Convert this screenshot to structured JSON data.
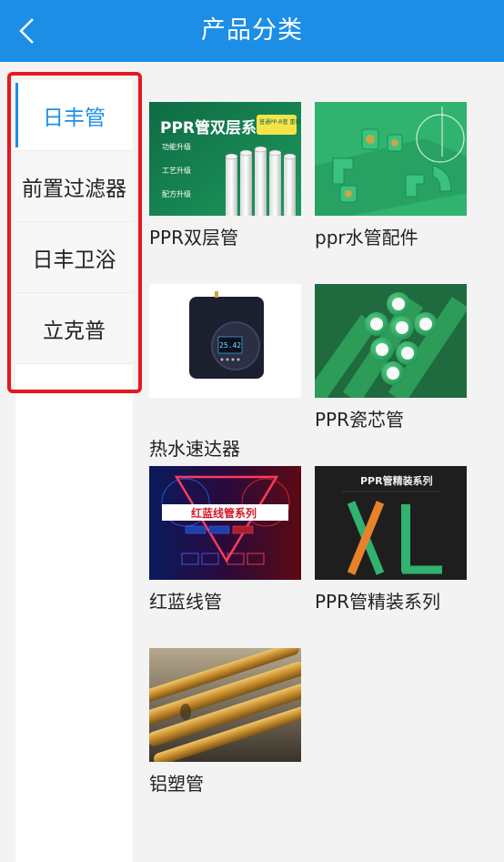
{
  "header": {
    "title": "产品分类"
  },
  "sidebar": {
    "items": [
      {
        "label": "日丰管",
        "active": true
      },
      {
        "label": "前置过滤器",
        "active": false
      },
      {
        "label": "日丰卫浴",
        "active": false
      },
      {
        "label": "立克普",
        "active": false
      }
    ]
  },
  "products": [
    {
      "name": "PPR双层管",
      "image": {
        "title_text": "PPR管双层系列",
        "lines": [
          "功能升级",
          "工艺升级",
          "配方升级"
        ],
        "badge": "普通PP-R管 重磅升级版"
      }
    },
    {
      "name": "ppr水管配件"
    },
    {
      "name": "热水速达器",
      "image": {
        "display": "25.42"
      }
    },
    {
      "name": "PPR瓷芯管"
    },
    {
      "name": "红蓝线管",
      "image": {
        "banner": "红蓝线管系列"
      }
    },
    {
      "name": "PPR管精装系列",
      "image": {
        "title_text": "PPR管精装系列",
        "big_letters": "XL"
      }
    },
    {
      "name": "铝塑管"
    }
  ],
  "colors": {
    "accent": "#1c8ee6",
    "highlight": "#e8161e"
  }
}
